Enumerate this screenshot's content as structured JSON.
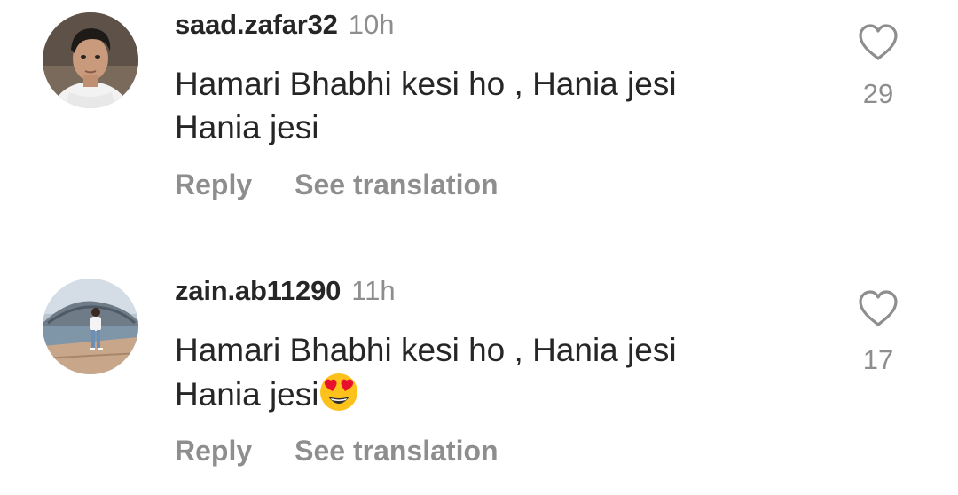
{
  "comments": [
    {
      "username": "saad.zafar32",
      "time": "10h",
      "text_line1": "Hamari Bhabhi kesi ho , Hania jesi",
      "text_line2": "Hania jesi",
      "reply_label": "Reply",
      "translate_label": "See translation",
      "likes": "29",
      "heart_icon": "heart-outline-icon"
    },
    {
      "username": "zain.ab11290",
      "time": "11h",
      "text_line1": "Hamari Bhabhi kesi ho , Hania jesi",
      "text_line2": "Hania jesi",
      "emoji": "heart-eyes-emoji",
      "reply_label": "Reply",
      "translate_label": "See translation",
      "likes": "17",
      "heart_icon": "heart-outline-icon"
    }
  ],
  "colors": {
    "primary_text": "#262626",
    "secondary_text": "#8e8e8e",
    "background": "#ffffff"
  }
}
